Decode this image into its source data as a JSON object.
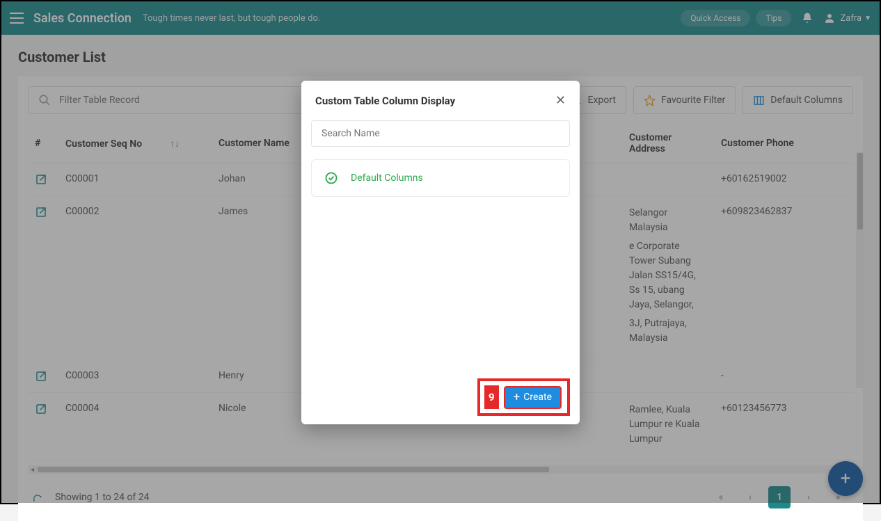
{
  "header": {
    "brand": "Sales Connection",
    "tagline": "Tough times never last, but tough people do.",
    "quick_access": "Quick Access",
    "tips": "Tips",
    "user_name": "Zafra"
  },
  "page": {
    "title": "Customer List",
    "search_placeholder": "Filter Table Record",
    "export": "Export",
    "fav_filter": "Favourite Filter",
    "default_cols": "Default Columns"
  },
  "table": {
    "headers": {
      "hash": "#",
      "seq": "Customer Seq No",
      "name": "Customer Name",
      "addr": "Customer Address",
      "phone": "Customer Phone"
    },
    "rows": [
      {
        "seq": "C00001",
        "name": "Johan",
        "addr_lines": [
          ""
        ],
        "phone": "+60162519002"
      },
      {
        "seq": "C00002",
        "name": "James",
        "addr_lines": [
          "Selangor Malaysia",
          "e Corporate Tower Subang Jalan SS15/4G, Ss 15, ubang Jaya, Selangor,",
          "3J, Putrajaya, Malaysia"
        ],
        "phone": "+609823462837"
      },
      {
        "seq": "C00003",
        "name": "Henry",
        "addr_lines": [
          ""
        ],
        "phone": "-"
      },
      {
        "seq": "C00004",
        "name": "Nicole",
        "addr_lines": [
          "Ramlee, Kuala Lumpur re Kuala Lumpur"
        ],
        "phone": "+60123456773"
      }
    ]
  },
  "footer": {
    "showing": "Showing 1 to 24 of 24",
    "page": "1"
  },
  "modal": {
    "title": "Custom Table Column Display",
    "search_placeholder": "Search Name",
    "item": "Default Columns",
    "create": "Create",
    "badge": "9"
  }
}
